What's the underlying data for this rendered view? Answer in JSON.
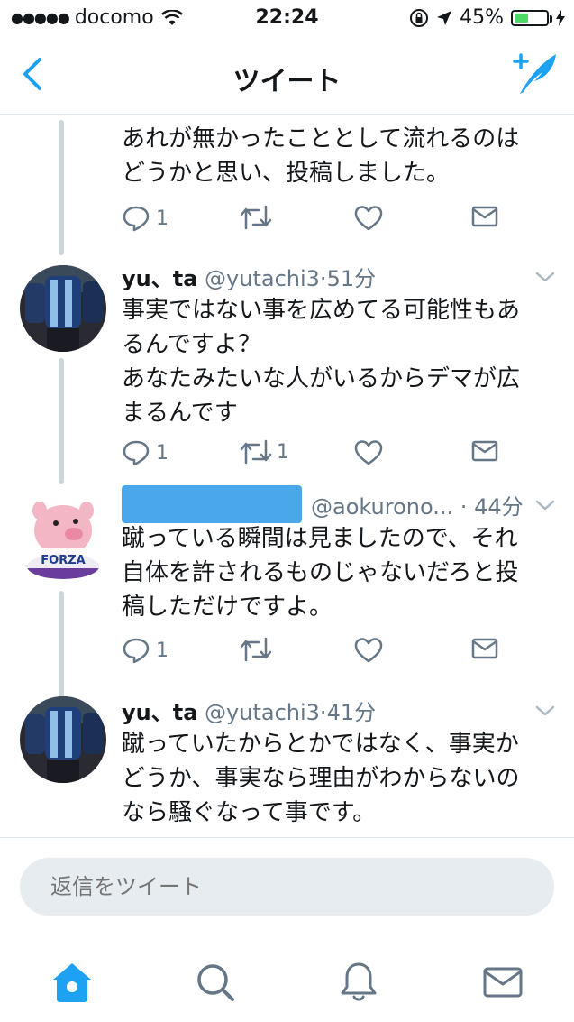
{
  "status_bar": {
    "carrier": "docomo",
    "time": "22:24",
    "battery": "45%",
    "battery_level": 0.45
  },
  "nav": {
    "title": "ツイート",
    "back_icon": "chevron-left-icon",
    "compose_icon": "compose-tweet-icon"
  },
  "tweets": [
    {
      "text_lines": [
        "あれが無かったこととして流れるのは",
        "どうかと思い、投稿しました。"
      ],
      "reply_count": "1",
      "retweet_count": "",
      "like_count": ""
    },
    {
      "name": "yu、ta",
      "handle": "@yutachi3",
      "sep": "·",
      "time": "51分",
      "text_lines": [
        "事実ではない事を広めてる可能性もあ",
        "るんですよ？",
        "あなたみたいな人がいるからデマが広",
        "まるんです"
      ],
      "reply_count": "1",
      "retweet_count": "1",
      "like_count": ""
    },
    {
      "name": "",
      "handle": "@aokurono...",
      "sep": "·",
      "time": "44分",
      "avatar_text": "FORZA",
      "text_lines": [
        "蹴っている瞬間は見ましたので、それ",
        "自体を許されるものじゃないだろと投",
        "稿しただけですよ。"
      ],
      "reply_count": "1",
      "retweet_count": "",
      "like_count": ""
    },
    {
      "name": "yu、ta",
      "handle": "@yutachi3",
      "sep": "·",
      "time": "41分",
      "text_lines": [
        "蹴っていたからとかではなく、事実か",
        "どうか、事実なら理由がわからないの",
        "なら騒ぐなって事です。"
      ]
    }
  ],
  "reply": {
    "placeholder": "返信をツイート"
  },
  "tabs": [
    "home-icon",
    "search-icon",
    "notifications-bell-icon",
    "messages-envelope-icon"
  ],
  "colors": {
    "accent": "#1da1f2",
    "secondary_text": "#657786",
    "thread_line": "#ccd6dd",
    "redaction": "#4aa8ea"
  }
}
